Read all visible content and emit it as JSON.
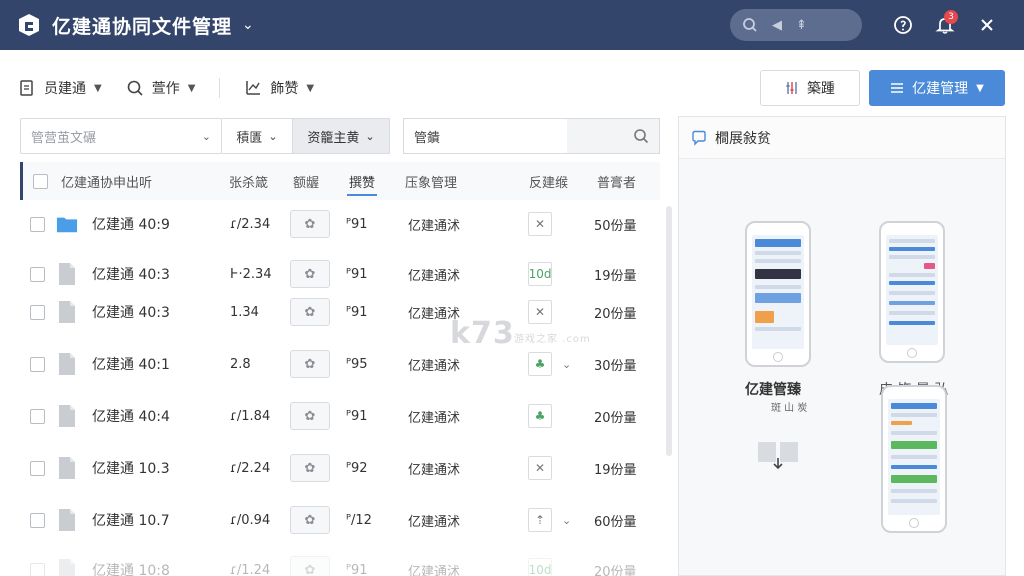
{
  "titlebar": {
    "title": "亿建通协同文件管理",
    "caret": "⌄",
    "search_glyphs": [
      "◀",
      "⇞"
    ],
    "notification_count": "3",
    "colors": {
      "background": "#33456b",
      "badge": "#e5484d"
    }
  },
  "toolbar": {
    "items": [
      {
        "label": "员建通",
        "icon": "upload-doc-icon"
      },
      {
        "label": "萱作",
        "icon": "search-icon"
      },
      {
        "label": "飾赞",
        "icon": "chart-icon"
      }
    ],
    "outline_button": "築踵",
    "primary_button": "亿建管理",
    "accent": "#4a8ad9"
  },
  "filters": {
    "select_placeholder": "管营茧文碾",
    "plain": "積匱",
    "active": "资籠主黄",
    "search_value": "管鐀"
  },
  "table": {
    "headers": [
      "亿建通协申出听",
      "张杀箴",
      "额龌",
      "撰赞",
      "压象管理",
      "反建缑",
      "普膏者"
    ],
    "rows": [
      {
        "name": "亿建通 40:9",
        "icon": "folder-icon",
        "value": "ɾ/2.34",
        "thumb": "✿",
        "version": "ᴾ91",
        "status": "亿建通沭",
        "flag": "✕",
        "flag_icon": "cross-icon",
        "caret": "",
        "size": "50份量"
      },
      {
        "name": "亿建通 40:3",
        "icon": "file-icon",
        "value": "Ͱ·2.34",
        "thumb": "✿",
        "version": "ᴾ91",
        "status": "亿建通沭",
        "flag": "10d",
        "flag_icon": "leaf-icon",
        "caret": "",
        "size": "19份量"
      },
      {
        "name": "亿建通 40:3",
        "icon": "file-icon",
        "value": "1.34",
        "thumb": "✿",
        "version": "ᴾ91",
        "status": "亿建通沭",
        "flag": "✕",
        "flag_icon": "cross-icon",
        "caret": "",
        "size": "20份量"
      },
      {
        "name": "亿建通 40:1",
        "icon": "file-icon",
        "value": "2.8",
        "thumb": "✿",
        "version": "ᴾ95",
        "status": "亿建通沭",
        "flag": "♣",
        "flag_icon": "leaf-icon",
        "caret": "⌄",
        "size": "30份量"
      },
      {
        "name": "亿建通 40:4",
        "icon": "file-icon",
        "value": "ɾ/1.84",
        "thumb": "✿",
        "version": "ᴾ91",
        "status": "亿建通沭",
        "flag": "♣",
        "flag_icon": "leaf-icon",
        "caret": "",
        "size": "20份量"
      },
      {
        "name": "亿建通 10.3",
        "icon": "file-icon",
        "value": "ɾ/2.24",
        "thumb": "✿",
        "version": "ᴾ92",
        "status": "亿建通沭",
        "flag": "✕",
        "flag_icon": "cross-icon",
        "caret": "",
        "size": "19份量"
      },
      {
        "name": "亿建通 10.7",
        "icon": "file-icon",
        "value": "ɾ/0.94",
        "thumb": "✿",
        "version": "ᴾ/12",
        "status": "亿建通沭",
        "flag": "⇡",
        "flag_icon": "upload-arrow-icon",
        "caret": "⌄",
        "size": "60份量"
      },
      {
        "name": "亿建通 10:8",
        "icon": "file-icon",
        "value": "ɾ/1.24",
        "thumb": "✿",
        "version": "ᴾ91",
        "status": "亿建通沭",
        "flag": "10d",
        "flag_icon": "leaf-icon",
        "caret": "",
        "size": "20份量"
      }
    ]
  },
  "preview": {
    "title": "橺展敍贫",
    "phone_label": "亿建管臻",
    "phone_sub": "斑 山 炭",
    "phone_label_2": "皮 饰 晏 弘"
  },
  "watermark": {
    "text": "k73",
    "sub": "游戏之家 .com"
  }
}
